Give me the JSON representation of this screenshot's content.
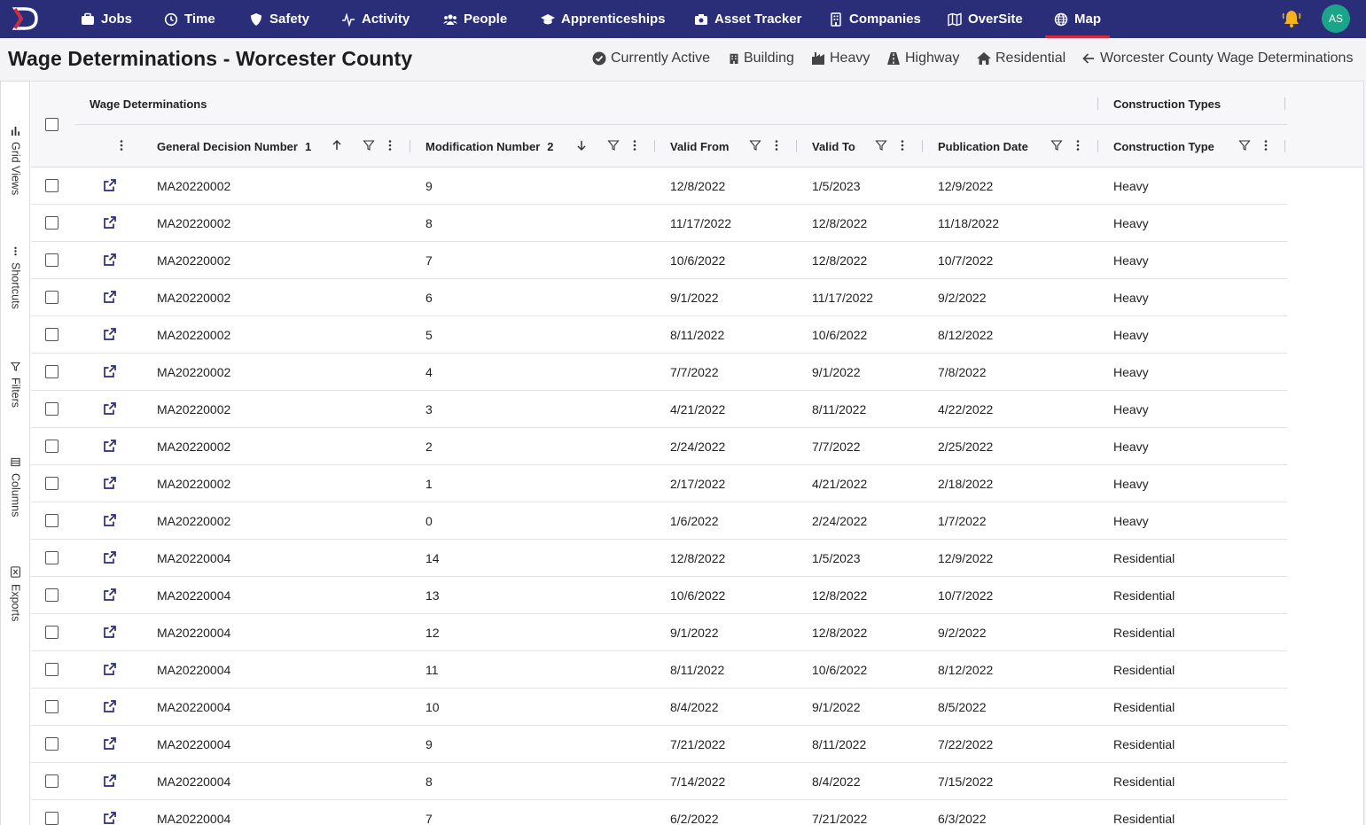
{
  "nav": {
    "items": [
      {
        "label": "Jobs",
        "icon": "briefcase-icon"
      },
      {
        "label": "Time",
        "icon": "clock-icon"
      },
      {
        "label": "Safety",
        "icon": "shield-icon"
      },
      {
        "label": "Activity",
        "icon": "pulse-icon"
      },
      {
        "label": "People",
        "icon": "people-icon"
      },
      {
        "label": "Apprenticeships",
        "icon": "graduation-cap-icon"
      },
      {
        "label": "Asset Tracker",
        "icon": "camera-icon"
      },
      {
        "label": "Companies",
        "icon": "building-icon"
      },
      {
        "label": "OverSite",
        "icon": "map-fold-icon"
      },
      {
        "label": "Map",
        "icon": "globe-icon",
        "active": true
      }
    ],
    "avatar_initials": "AS",
    "accent_color": "#2a2d78",
    "active_underline_color": "#d7263d"
  },
  "page": {
    "title": "Wage Determinations - Worcester County",
    "filters": [
      {
        "label": "Currently Active",
        "icon": "check-circle-icon"
      },
      {
        "label": "Building",
        "icon": "building-icon"
      },
      {
        "label": "Heavy",
        "icon": "industry-icon"
      },
      {
        "label": "Highway",
        "icon": "road-icon"
      },
      {
        "label": "Residential",
        "icon": "house-icon"
      },
      {
        "label": "Worcester County Wage Determinations",
        "icon": "arrow-left-icon"
      }
    ]
  },
  "side_panel": {
    "tabs": [
      "Grid Views",
      "Shortcuts",
      "Filters",
      "Columns",
      "Exports"
    ]
  },
  "grid": {
    "groups": {
      "wage": "Wage Determinations",
      "construction": "Construction Types"
    },
    "columns": {
      "decision": "General Decision Number",
      "decision_sort_index": "1",
      "modification": "Modification Number",
      "modification_sort_index": "2",
      "valid_from": "Valid From",
      "valid_to": "Valid To",
      "publication": "Publication Date",
      "construction_type": "Construction Type"
    },
    "rows": [
      {
        "decision": "MA20220002",
        "mod": "9",
        "from": "12/8/2022",
        "to": "1/5/2023",
        "pub": "12/9/2022",
        "type": "Heavy"
      },
      {
        "decision": "MA20220002",
        "mod": "8",
        "from": "11/17/2022",
        "to": "12/8/2022",
        "pub": "11/18/2022",
        "type": "Heavy"
      },
      {
        "decision": "MA20220002",
        "mod": "7",
        "from": "10/6/2022",
        "to": "12/8/2022",
        "pub": "10/7/2022",
        "type": "Heavy"
      },
      {
        "decision": "MA20220002",
        "mod": "6",
        "from": "9/1/2022",
        "to": "11/17/2022",
        "pub": "9/2/2022",
        "type": "Heavy"
      },
      {
        "decision": "MA20220002",
        "mod": "5",
        "from": "8/11/2022",
        "to": "10/6/2022",
        "pub": "8/12/2022",
        "type": "Heavy"
      },
      {
        "decision": "MA20220002",
        "mod": "4",
        "from": "7/7/2022",
        "to": "9/1/2022",
        "pub": "7/8/2022",
        "type": "Heavy"
      },
      {
        "decision": "MA20220002",
        "mod": "3",
        "from": "4/21/2022",
        "to": "8/11/2022",
        "pub": "4/22/2022",
        "type": "Heavy"
      },
      {
        "decision": "MA20220002",
        "mod": "2",
        "from": "2/24/2022",
        "to": "7/7/2022",
        "pub": "2/25/2022",
        "type": "Heavy"
      },
      {
        "decision": "MA20220002",
        "mod": "1",
        "from": "2/17/2022",
        "to": "4/21/2022",
        "pub": "2/18/2022",
        "type": "Heavy"
      },
      {
        "decision": "MA20220002",
        "mod": "0",
        "from": "1/6/2022",
        "to": "2/24/2022",
        "pub": "1/7/2022",
        "type": "Heavy"
      },
      {
        "decision": "MA20220004",
        "mod": "14",
        "from": "12/8/2022",
        "to": "1/5/2023",
        "pub": "12/9/2022",
        "type": "Residential"
      },
      {
        "decision": "MA20220004",
        "mod": "13",
        "from": "10/6/2022",
        "to": "12/8/2022",
        "pub": "10/7/2022",
        "type": "Residential"
      },
      {
        "decision": "MA20220004",
        "mod": "12",
        "from": "9/1/2022",
        "to": "12/8/2022",
        "pub": "9/2/2022",
        "type": "Residential"
      },
      {
        "decision": "MA20220004",
        "mod": "11",
        "from": "8/11/2022",
        "to": "10/6/2022",
        "pub": "8/12/2022",
        "type": "Residential"
      },
      {
        "decision": "MA20220004",
        "mod": "10",
        "from": "8/4/2022",
        "to": "9/1/2022",
        "pub": "8/5/2022",
        "type": "Residential"
      },
      {
        "decision": "MA20220004",
        "mod": "9",
        "from": "7/21/2022",
        "to": "8/11/2022",
        "pub": "7/22/2022",
        "type": "Residential"
      },
      {
        "decision": "MA20220004",
        "mod": "8",
        "from": "7/14/2022",
        "to": "8/4/2022",
        "pub": "7/15/2022",
        "type": "Residential"
      },
      {
        "decision": "MA20220004",
        "mod": "7",
        "from": "6/2/2022",
        "to": "7/21/2022",
        "pub": "6/3/2022",
        "type": "Residential"
      }
    ]
  }
}
